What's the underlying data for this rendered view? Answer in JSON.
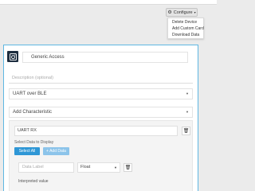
{
  "toolbar": {
    "configure_label": "Configure",
    "gear_icon": "gear-icon",
    "caret_glyph": "▾"
  },
  "configure_menu": {
    "items": [
      "Delete Device",
      "Add Custom Card",
      "Download Data"
    ]
  },
  "service": {
    "name": "Generic Access",
    "description_placeholder": "Description (optional)",
    "transport_selected": "UART over BLE",
    "add_characteristic_label": "Add Characteristic"
  },
  "characteristic": {
    "name": "UART RX",
    "select_data_label": "Select Data to Display",
    "select_all_label": "Select All",
    "add_data_label": "+ Add Data",
    "data_label_placeholder": "Data Label",
    "type_selected": "Float",
    "interpreted_label": "Interpreted value"
  },
  "colors": {
    "accent_blue": "#2f97d6",
    "light_blue": "#8cc4ea",
    "card_border": "#5fb7e2",
    "icon_bg": "#1d2d3f"
  }
}
